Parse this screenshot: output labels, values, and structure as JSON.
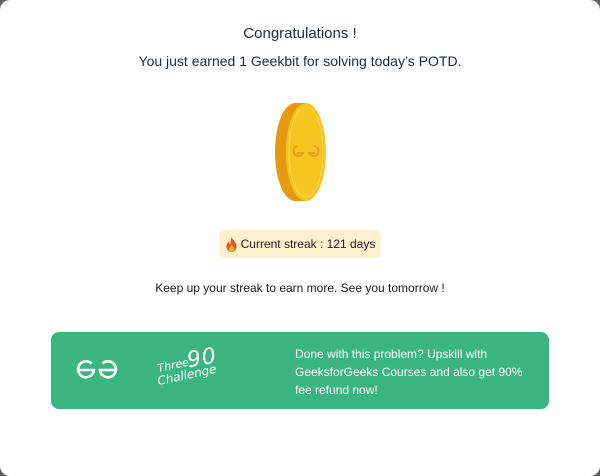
{
  "modal": {
    "title": "Congratulations !",
    "subtitle": "You just earned 1 Geekbit for solving today’s POTD.",
    "streak_text": "Current streak : 121 days",
    "keepup_text": "Keep up your streak to earn more. See you tomorrow !"
  },
  "promo": {
    "logo_icon": "gfg-logo-icon",
    "challenge_three": "Three",
    "challenge_ninety": "90",
    "challenge_word": "Challenge",
    "text": "Done with this problem? Upskill with GeeksforGeeks Courses and also get 90% fee refund now!",
    "background_color": "#3bb57f"
  },
  "icons": {
    "coin": "geekbit-coin-icon",
    "fire": "fire-icon"
  },
  "colors": {
    "coin_gold": "#f5c21b",
    "coin_edge": "#e59a10",
    "badge_bg": "#fcf0cd"
  }
}
